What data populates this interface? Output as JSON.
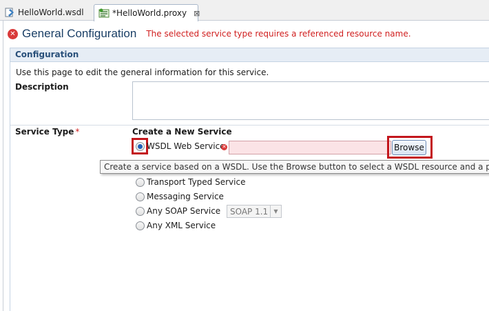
{
  "tabs": [
    {
      "label": "HelloWorld.wsdl",
      "icon": "wsdl-file-icon",
      "active": false
    },
    {
      "label": "*HelloWorld.proxy",
      "icon": "proxy-file-icon",
      "active": true,
      "close": "⊠"
    }
  ],
  "header": {
    "title": "General Configuration",
    "message": "The selected service type requires a referenced resource name."
  },
  "section": {
    "title": "Configuration",
    "intro": "Use this page to edit the general information for this service."
  },
  "description": {
    "label": "Description",
    "value": ""
  },
  "service_type": {
    "label": "Service Type",
    "required_mark": "*",
    "group_title": "Create a New Service",
    "options": [
      {
        "label": "WSDL Web Service",
        "checked": true
      },
      {
        "label": "Transport Typed Service",
        "checked": false
      },
      {
        "label": "Messaging Service",
        "checked": false
      },
      {
        "label": "Any SOAP Service",
        "checked": false
      },
      {
        "label": "Any XML Service",
        "checked": false
      }
    ],
    "wsdl_value": "",
    "browse_label": "Browse",
    "soap_version": "SOAP 1.1",
    "tooltip": "Create a service based on a WSDL. Use the Browse button to select a WSDL resource and a port or bind"
  },
  "colors": {
    "error": "#d01e1e",
    "highlight": "#c3161c",
    "title": "#1a3f66",
    "section_bg": "#e6edf5"
  }
}
